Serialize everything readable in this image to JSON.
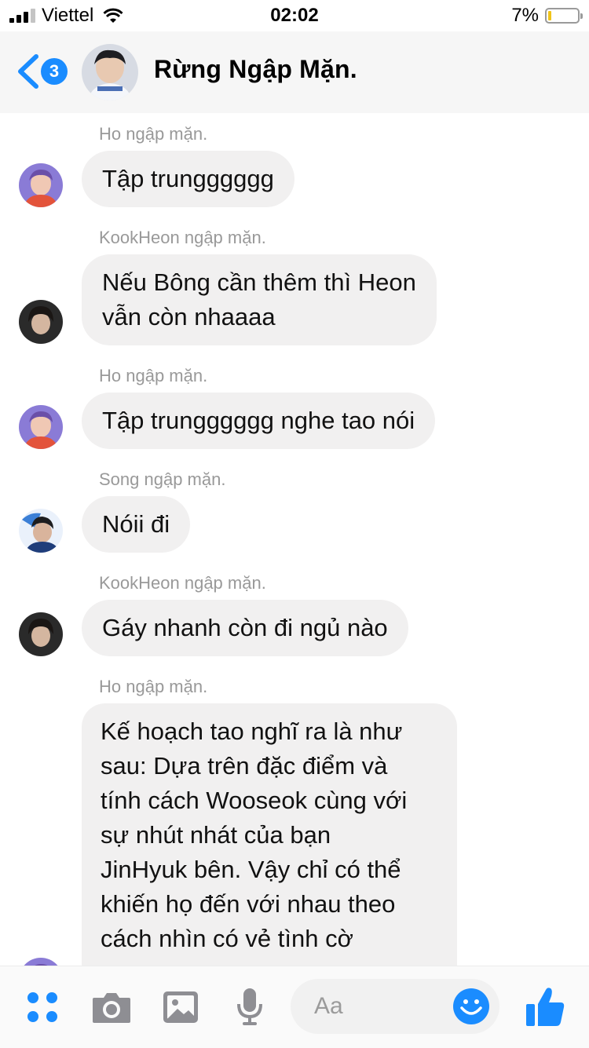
{
  "status_bar": {
    "carrier": "Viettel",
    "time": "02:02",
    "battery": "7%"
  },
  "header": {
    "back_count": "3",
    "title": "Rừng Ngập Mặn."
  },
  "messages": [
    {
      "sender": "Ho ngập mặn.",
      "text": "Tập trungggggg"
    },
    {
      "sender": "KookHeon ngập mặn.",
      "line1": "Nếu Bông cần thêm thì Heon",
      "line2": "vẫn còn nhaaaa"
    },
    {
      "sender": "Ho ngập mặn.",
      "text": "Tập trungggggg nghe tao nói"
    },
    {
      "sender": "Song ngập mặn.",
      "text": "Nóii đi"
    },
    {
      "sender": "KookHeon ngập mặn.",
      "text": "Gáy nhanh còn đi ngủ nào"
    },
    {
      "sender": "Ho ngập mặn.",
      "lines": [
        "Kế hoạch tao nghĩ ra là như",
        "sau: Dựa trên đặc điểm và",
        "tính cách Wooseok cùng với",
        "sự nhút nhát của bạn",
        "JinHyuk bên. Vậy chỉ có thể",
        "khiến họ đến với nhau theo",
        "cách nhìn có vẻ tình cờ"
      ]
    }
  ],
  "composer": {
    "placeholder": "Aa",
    "icons": [
      "menu-dots-icon",
      "camera-icon",
      "image-icon",
      "microphone-icon",
      "emoji-icon",
      "thumbs-up-icon"
    ]
  },
  "colors": {
    "accent": "#1a8cff",
    "bubble": "#f1f0f0",
    "sender": "#999999"
  }
}
